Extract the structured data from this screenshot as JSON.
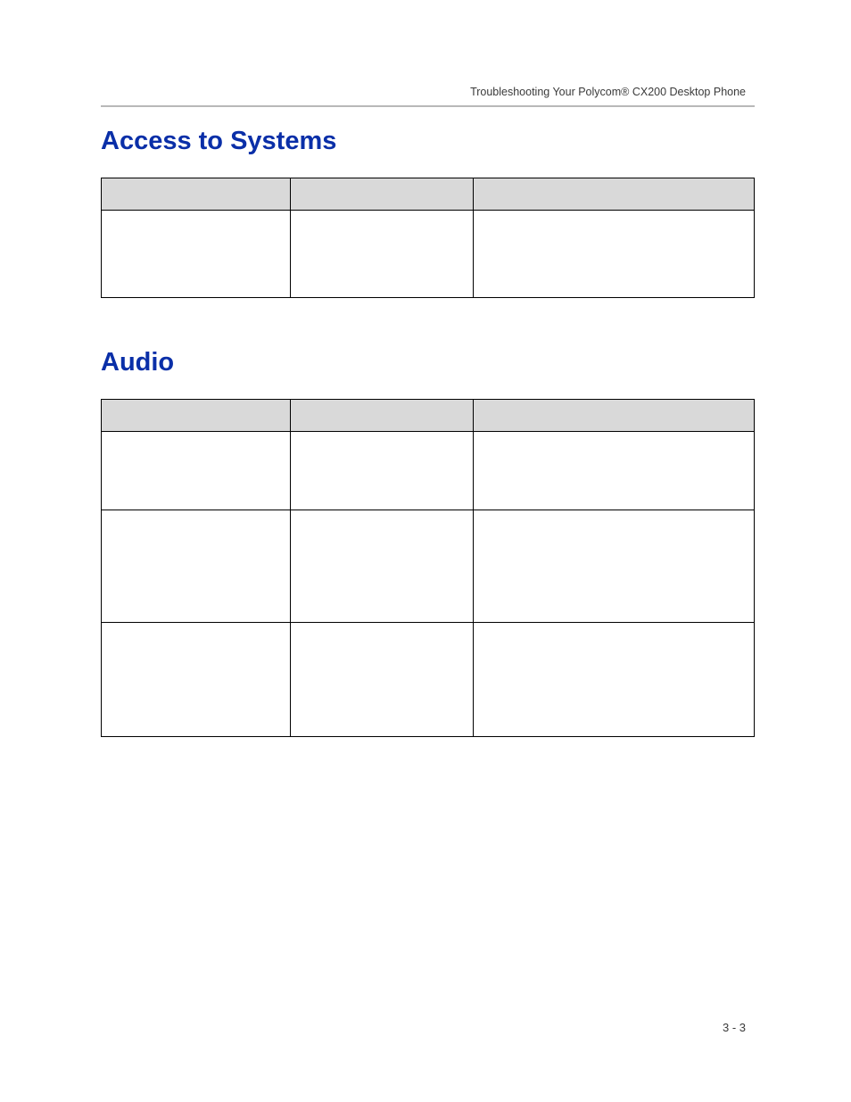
{
  "running_head": "Troubleshooting Your Polycom® CX200 Desktop Phone",
  "sections": {
    "s1": {
      "title": "Access to Systems"
    },
    "s2": {
      "title": "Audio"
    }
  },
  "page_number": "3 - 3"
}
